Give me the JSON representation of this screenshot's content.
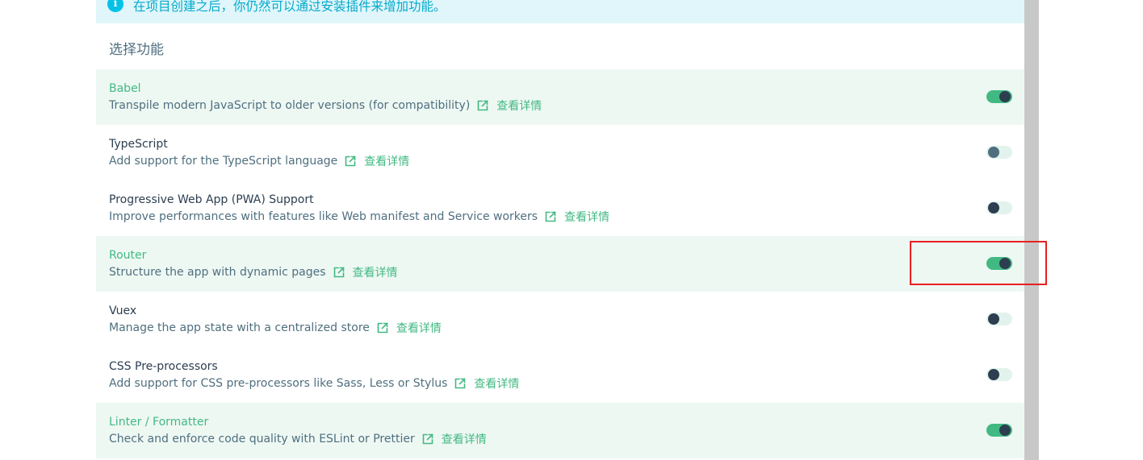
{
  "info_banner": {
    "text": "在项目创建之后，你仍然可以通过安装插件来增加功能。"
  },
  "section": {
    "title": "选择功能"
  },
  "link_label": "查看详情",
  "features": [
    {
      "name": "Babel",
      "description": "Transpile modern JavaScript to older versions (for compatibility)",
      "enabled": true
    },
    {
      "name": "TypeScript",
      "description": "Add support for the TypeScript language",
      "enabled": false
    },
    {
      "name": "Progressive Web App (PWA) Support",
      "description": "Improve performances with features like Web manifest and Service workers",
      "enabled": false
    },
    {
      "name": "Router",
      "description": "Structure the app with dynamic pages",
      "enabled": true
    },
    {
      "name": "Vuex",
      "description": "Manage the app state with a centralized store",
      "enabled": false
    },
    {
      "name": "CSS Pre-processors",
      "description": "Add support for CSS pre-processors like Sass, Less or Stylus",
      "enabled": false
    },
    {
      "name": "Linter / Formatter",
      "description": "Check and enforce code quality with ESLint or Prettier",
      "enabled": true
    }
  ],
  "icons": {
    "info": "info-icon",
    "external_link": "external-link-icon"
  },
  "colors": {
    "accent": "#42b983",
    "text_dark": "#2c3e50",
    "text_muted": "#4f6f7f",
    "selected_row_bg": "#eef8f3",
    "info_bg": "#e0f6fb",
    "info_text": "#03a9cb",
    "annotation_red": "#e82020"
  }
}
